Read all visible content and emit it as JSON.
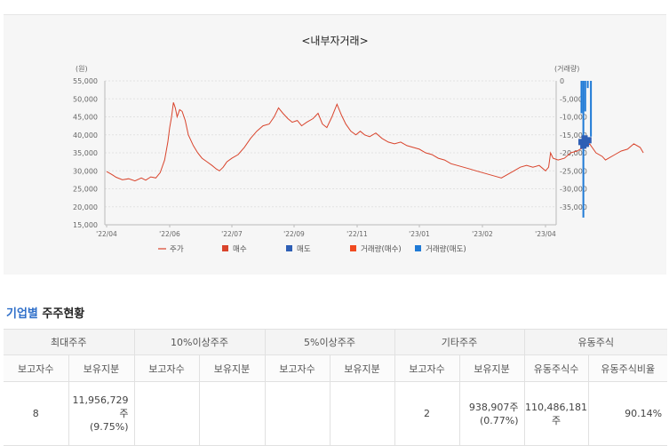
{
  "chart": {
    "title": "<내부자거래>",
    "left_unit": "(원)",
    "right_unit": "(거래량)",
    "left_ticks": [
      "55,000",
      "50,000",
      "45,000",
      "40,000",
      "35,000",
      "30,000",
      "25,000",
      "20,000",
      "15,000"
    ],
    "right_ticks": [
      "0",
      "-5,000",
      "-10,000",
      "-15,000",
      "-20,000",
      "-25,000",
      "-30,000",
      "-35,000"
    ],
    "x_ticks": [
      "'22/04",
      "'22/06",
      "'22/07",
      "'22/09",
      "'22/11",
      "'23/01",
      "'23/02",
      "'23/04"
    ],
    "legend": [
      {
        "label": "주가",
        "kind": "line",
        "color": "#d9442c"
      },
      {
        "label": "매수",
        "kind": "square",
        "color": "#d9442c"
      },
      {
        "label": "매도",
        "kind": "square",
        "color": "#2e5fb5"
      },
      {
        "label": "거래량(매수)",
        "kind": "square",
        "color": "#f04a20"
      },
      {
        "label": "거래량(매도)",
        "kind": "square",
        "color": "#1f7ad6"
      }
    ]
  },
  "chart_data": {
    "type": "line",
    "title": "<내부자거래>",
    "ylabel": "(원)",
    "y2label": "(거래량)",
    "ylim": [
      15000,
      55000
    ],
    "y2lim": [
      -40000,
      0
    ],
    "x_tick_labels": [
      "'22/04",
      "'22/06",
      "'22/07",
      "'22/09",
      "'22/11",
      "'23/01",
      "'23/02",
      "'23/04"
    ],
    "series": [
      {
        "name": "주가",
        "points": [
          [
            0,
            29800
          ],
          [
            0.08,
            29000
          ],
          [
            0.15,
            28200
          ],
          [
            0.25,
            27500
          ],
          [
            0.35,
            27800
          ],
          [
            0.45,
            27200
          ],
          [
            0.55,
            28000
          ],
          [
            0.62,
            27400
          ],
          [
            0.7,
            28300
          ],
          [
            0.78,
            28000
          ],
          [
            0.85,
            29500
          ],
          [
            0.92,
            33000
          ],
          [
            0.97,
            38000
          ],
          [
            1.0,
            42000
          ],
          [
            1.03,
            45000
          ],
          [
            1.06,
            49000
          ],
          [
            1.09,
            47500
          ],
          [
            1.12,
            45000
          ],
          [
            1.16,
            47000
          ],
          [
            1.2,
            46500
          ],
          [
            1.25,
            44000
          ],
          [
            1.3,
            40000
          ],
          [
            1.38,
            37000
          ],
          [
            1.45,
            35000
          ],
          [
            1.52,
            33500
          ],
          [
            1.6,
            32500
          ],
          [
            1.68,
            31500
          ],
          [
            1.75,
            30500
          ],
          [
            1.8,
            30000
          ],
          [
            1.86,
            31000
          ],
          [
            1.92,
            32500
          ],
          [
            2.0,
            33500
          ],
          [
            2.1,
            34500
          ],
          [
            2.2,
            36500
          ],
          [
            2.3,
            39000
          ],
          [
            2.4,
            41000
          ],
          [
            2.5,
            42500
          ],
          [
            2.6,
            43000
          ],
          [
            2.68,
            45000
          ],
          [
            2.75,
            47500
          ],
          [
            2.82,
            46000
          ],
          [
            2.9,
            44500
          ],
          [
            2.97,
            43500
          ],
          [
            3.05,
            44000
          ],
          [
            3.12,
            42500
          ],
          [
            3.2,
            43500
          ],
          [
            3.3,
            44500
          ],
          [
            3.38,
            46000
          ],
          [
            3.45,
            43000
          ],
          [
            3.52,
            42000
          ],
          [
            3.6,
            45000
          ],
          [
            3.68,
            48500
          ],
          [
            3.75,
            45500
          ],
          [
            3.82,
            43000
          ],
          [
            3.9,
            41000
          ],
          [
            3.98,
            40000
          ],
          [
            4.05,
            41000
          ],
          [
            4.12,
            40000
          ],
          [
            4.2,
            39500
          ],
          [
            4.3,
            40500
          ],
          [
            4.4,
            39000
          ],
          [
            4.5,
            38000
          ],
          [
            4.6,
            37500
          ],
          [
            4.7,
            38000
          ],
          [
            4.8,
            37000
          ],
          [
            4.9,
            36500
          ],
          [
            5.0,
            36000
          ],
          [
            5.1,
            35000
          ],
          [
            5.2,
            34500
          ],
          [
            5.3,
            33500
          ],
          [
            5.4,
            33000
          ],
          [
            5.5,
            32000
          ],
          [
            5.6,
            31500
          ],
          [
            5.7,
            31000
          ],
          [
            5.8,
            30500
          ],
          [
            5.9,
            30000
          ],
          [
            6.0,
            29500
          ],
          [
            6.1,
            29000
          ],
          [
            6.2,
            28500
          ],
          [
            6.3,
            28000
          ],
          [
            6.4,
            29000
          ],
          [
            6.5,
            30000
          ],
          [
            6.6,
            31000
          ],
          [
            6.7,
            31500
          ],
          [
            6.8,
            31000
          ],
          [
            6.9,
            31500
          ],
          [
            7.0,
            30000
          ],
          [
            7.05,
            31000
          ],
          [
            7.08,
            35000
          ],
          [
            7.12,
            33500
          ],
          [
            7.2,
            33000
          ],
          [
            7.3,
            33500
          ],
          [
            7.4,
            35000
          ],
          [
            7.5,
            35500
          ],
          [
            7.55,
            36000
          ],
          [
            7.62,
            36500
          ],
          [
            7.7,
            37500
          ],
          [
            7.8,
            35000
          ],
          [
            7.9,
            34000
          ],
          [
            7.95,
            33000
          ],
          [
            8.0,
            33500
          ],
          [
            8.1,
            34500
          ],
          [
            8.2,
            35500
          ],
          [
            8.3,
            36000
          ],
          [
            8.4,
            37500
          ],
          [
            8.5,
            36500
          ],
          [
            8.55,
            35000
          ]
        ]
      },
      {
        "name": "매도",
        "points": [
          [
            7.57,
            38000
          ],
          [
            7.62,
            39000
          ],
          [
            7.68,
            38500
          ],
          [
            7.6,
            37000
          ],
          [
            7.64,
            37500
          ]
        ]
      },
      {
        "name": "거래량(매도)",
        "bars": [
          [
            7.57,
            -9000
          ],
          [
            7.6,
            -38000
          ],
          [
            7.63,
            -8500
          ],
          [
            7.67,
            -2000
          ],
          [
            7.72,
            -15500
          ]
        ]
      }
    ]
  },
  "section": {
    "accent": "기업별",
    "title": " 주주현황"
  },
  "table": {
    "groups": [
      "최대주주",
      "10%이상주주",
      "5%이상주주",
      "기타주주",
      "유동주식"
    ],
    "subheaders": [
      "보고자수",
      "보유지분",
      "보고자수",
      "보유지분",
      "보고자수",
      "보유지분",
      "보고자수",
      "보유지분",
      "유동주식수",
      "유동주식비율"
    ],
    "row": {
      "max_count": "8",
      "max_shares": "11,956,729주",
      "max_pct": "(9.75%)",
      "ten_count": "",
      "ten_shares": "",
      "five_count": "",
      "five_shares": "",
      "etc_count": "2",
      "etc_shares": "938,907주",
      "etc_pct": "(0.77%)",
      "float_shares_line1": "110,486,181",
      "float_shares_line2": "주",
      "float_ratio": "90.14%"
    }
  }
}
